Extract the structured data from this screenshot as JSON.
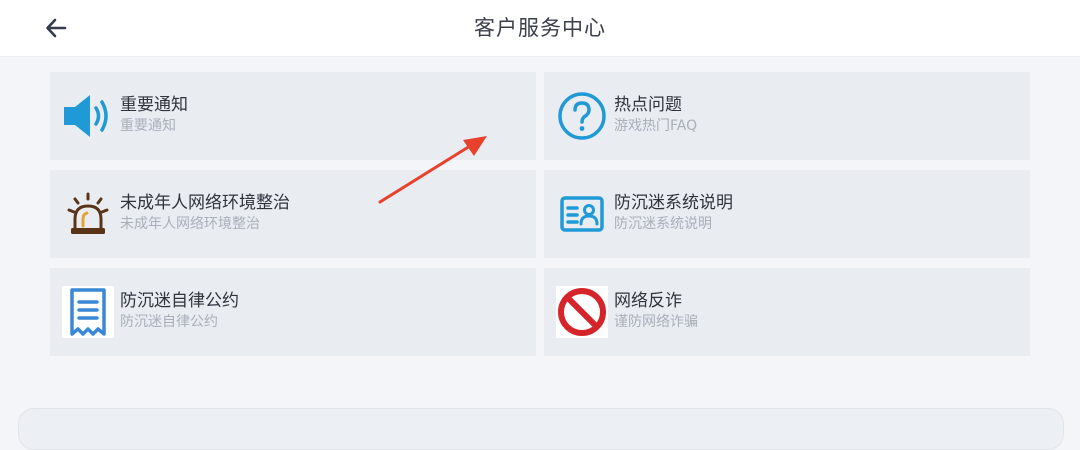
{
  "header": {
    "title": "客户服务中心",
    "back_icon": "arrow-left-icon"
  },
  "cards": [
    {
      "title": "重要通知",
      "subtitle": "重要通知",
      "icon": "speaker-icon"
    },
    {
      "title": "热点问题",
      "subtitle": "游戏热门FAQ",
      "icon": "question-circle-icon"
    },
    {
      "title": "未成年人网络环境整治",
      "subtitle": "未成年人网络环境整治",
      "icon": "alarm-siren-icon"
    },
    {
      "title": "防沉迷系统说明",
      "subtitle": "防沉迷系统说明",
      "icon": "id-card-icon"
    },
    {
      "title": "防沉迷自律公约",
      "subtitle": "防沉迷自律公约",
      "icon": "receipt-icon"
    },
    {
      "title": "网络反诈",
      "subtitle": "谨防网络诈骗",
      "icon": "prohibited-icon"
    }
  ],
  "colors": {
    "accent_blue": "#1f9ad6",
    "annotation_red": "#e8412c",
    "siren_brown": "#5a3417",
    "prohibit_red": "#d6252a"
  }
}
